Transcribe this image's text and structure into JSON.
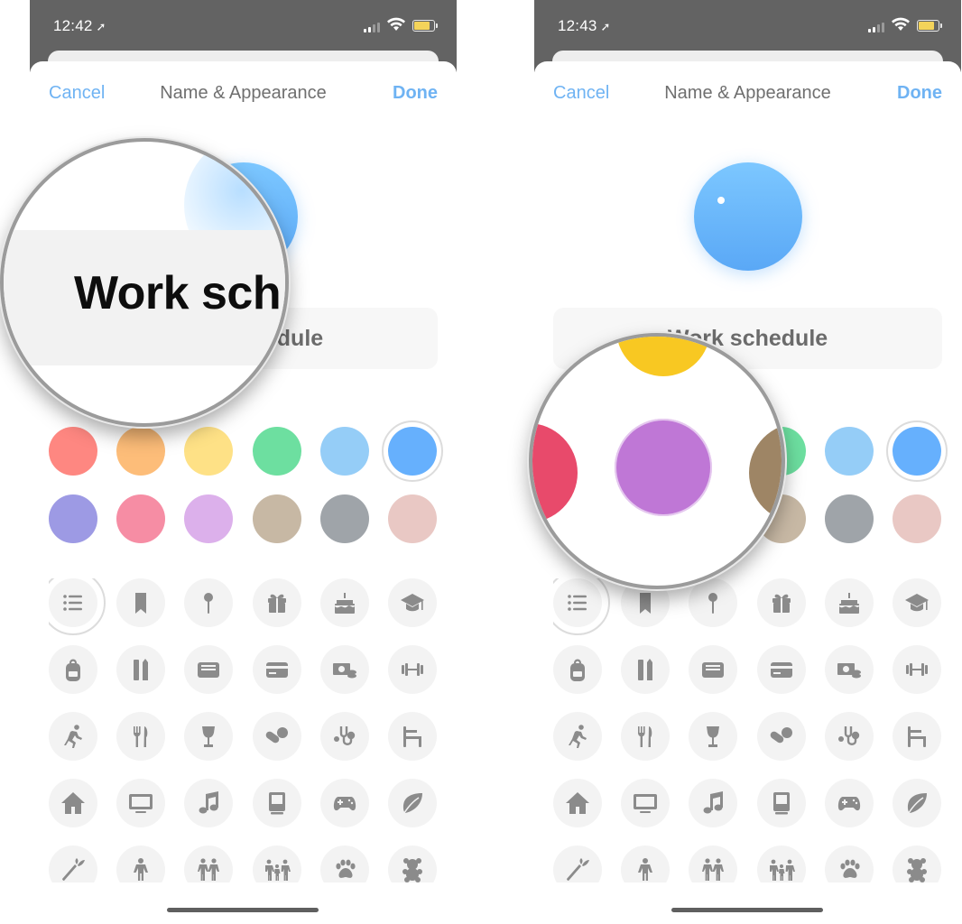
{
  "screens": [
    {
      "time": "12:42",
      "nav": {
        "cancel": "Cancel",
        "title": "Name & Appearance",
        "done": "Done"
      },
      "list_name": "Work schedule",
      "magnifier_text": "Work sch",
      "magnifier_target": "list-name-field",
      "selected_color": "blue",
      "selected_icon": "list-bullet"
    },
    {
      "time": "12:43",
      "nav": {
        "cancel": "Cancel",
        "title": "Name & Appearance",
        "done": "Done"
      },
      "list_name": "Work schedule",
      "magnifier_target": "purple-swatch",
      "magnifier_colors": [
        "#e84a6b",
        "#bf77d6",
        "#9e8565",
        "#f8c822"
      ],
      "selected_color": "blue",
      "selected_icon": "list-bullet"
    }
  ],
  "colors": [
    {
      "name": "red",
      "hex": "#fe8781"
    },
    {
      "name": "orange",
      "hex": "#fdbd79"
    },
    {
      "name": "yellow",
      "hex": "#fee186"
    },
    {
      "name": "green",
      "hex": "#6ddfa0"
    },
    {
      "name": "light-blue",
      "hex": "#95cdf7"
    },
    {
      "name": "blue",
      "hex": "#66b0fd"
    },
    {
      "name": "indigo",
      "hex": "#9d9ae4"
    },
    {
      "name": "pink",
      "hex": "#f68da4"
    },
    {
      "name": "purple",
      "hex": "#dcb0eb"
    },
    {
      "name": "brown",
      "hex": "#c7b8a4"
    },
    {
      "name": "gray",
      "hex": "#9fa4a9"
    },
    {
      "name": "rose-gold",
      "hex": "#e9c8c4"
    }
  ],
  "icons": [
    "list-bullet",
    "bookmark",
    "pin",
    "gift",
    "birthday-cake",
    "graduation-cap",
    "backpack",
    "ruler-pencil",
    "document-tray",
    "credit-card",
    "money",
    "dumbbell",
    "running",
    "fork-knife",
    "wine-glass",
    "pills",
    "stethoscope",
    "chair",
    "house",
    "tv",
    "music-note",
    "computer",
    "gamepad",
    "leaf",
    "carrot",
    "person",
    "two-people",
    "family",
    "paw",
    "teddy-bear"
  ]
}
